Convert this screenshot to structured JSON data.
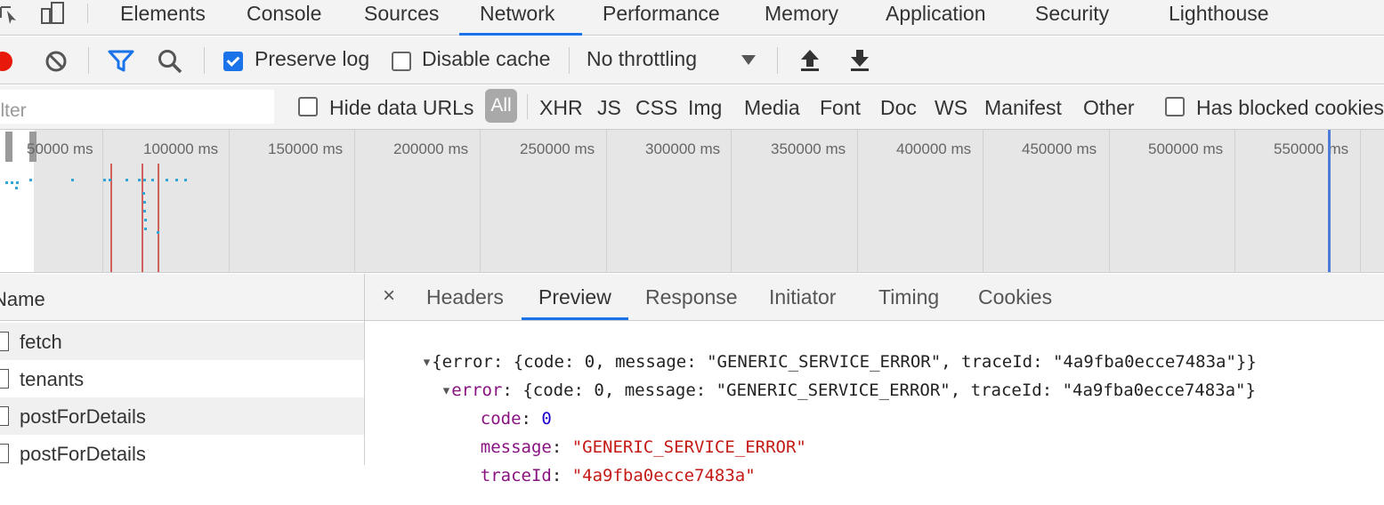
{
  "tabs": [
    "Elements",
    "Console",
    "Sources",
    "Network",
    "Performance",
    "Memory",
    "Application",
    "Security",
    "Lighthouse"
  ],
  "active_tab": "Network",
  "toolbar": {
    "preserve_log": "Preserve log",
    "preserve_log_checked": true,
    "disable_cache": "Disable cache",
    "disable_cache_checked": false,
    "throttling": "No throttling"
  },
  "filter": {
    "placeholder": "Filter",
    "hide_data_urls": "Hide data URLs",
    "types": [
      "All",
      "XHR",
      "JS",
      "CSS",
      "Img",
      "Media",
      "Font",
      "Doc",
      "WS",
      "Manifest",
      "Other"
    ],
    "has_blocked_cookies": "Has blocked cookies"
  },
  "timeline": {
    "ticks": [
      "50000 ms",
      "100000 ms",
      "150000 ms",
      "200000 ms",
      "250000 ms",
      "300000 ms",
      "350000 ms",
      "400000 ms",
      "450000 ms",
      "500000 ms",
      "550000 ms"
    ]
  },
  "requests": {
    "header": "Name",
    "items": [
      "fetch",
      "tenants",
      "postForDetails",
      "postForDetails"
    ]
  },
  "detail": {
    "tabs": [
      "Headers",
      "Preview",
      "Response",
      "Initiator",
      "Timing",
      "Cookies"
    ],
    "active_tab": "Preview",
    "close": "×",
    "preview": {
      "root_summary": "{error: {code: 0, message: \"GENERIC_SERVICE_ERROR\", traceId: \"4a9fba0ecce7483a\"}}",
      "error_key": "error",
      "error_summary": "{code: 0, message: \"GENERIC_SERVICE_ERROR\", traceId: \"4a9fba0ecce7483a\"}",
      "code_key": "code",
      "code_value": "0",
      "message_key": "message",
      "message_value": "\"GENERIC_SERVICE_ERROR\"",
      "traceId_key": "traceId",
      "traceId_value": "\"4a9fba0ecce7483a\""
    }
  },
  "colors": {
    "accent": "#1a73e8",
    "record": "#e8190b"
  }
}
